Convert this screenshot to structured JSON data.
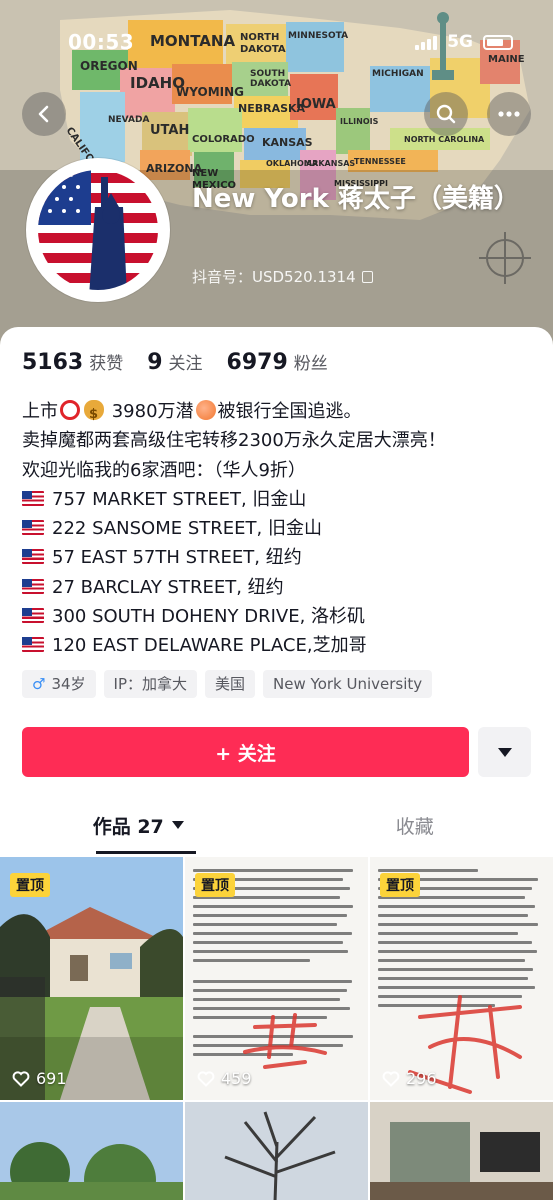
{
  "status_bar": {
    "time": "00:53",
    "network": "5G"
  },
  "profile": {
    "name": "New York  蒋太子（美籍）",
    "douyin_id": "抖音号：USD520.1314"
  },
  "stats": [
    {
      "value": "5163",
      "label": "获赞"
    },
    {
      "value": "9",
      "label": "关注"
    },
    {
      "value": "6979",
      "label": "粉丝"
    }
  ],
  "bio": {
    "line1_a": "上市",
    "line1_b": "3980万潜",
    "line1_c": "被银行全国追逃。",
    "line2": "卖掉魔都两套高级住宅转移2300万永久定居大漂亮！",
    "line3": "欢迎光临我的6家酒吧：（华人9折）",
    "addresses": [
      "757 MARKET STREET, 旧金山",
      "222 SANSOME STREET, 旧金山",
      "57 EAST 57TH STREET, 纽约",
      "27 BARCLAY STREET, 纽约",
      "300 SOUTH DOHENY DRIVE, 洛杉矶",
      "120 EAST DELAWARE PLACE,芝加哥"
    ]
  },
  "tags": {
    "gender_symbol": "♂",
    "age": "34岁",
    "ip": "IP：加拿大",
    "country": "美国",
    "school": "New York University"
  },
  "actions": {
    "follow_label": "+ 关注"
  },
  "tabs": {
    "works": "作品 27",
    "favorites": "收藏"
  },
  "videos": [
    {
      "pinned": "置顶",
      "likes": "691"
    },
    {
      "pinned": "置顶",
      "likes": "459"
    },
    {
      "pinned": "置顶",
      "likes": "296"
    }
  ],
  "map_labels": [
    "MONTANA",
    "NORTH DAKOTA",
    "MINNESOTA",
    "OREGON",
    "IDAHO",
    "WYOMING",
    "SOUTH DAKOTA",
    "NEBRASKA",
    "IOWA",
    "MICHIGAN",
    "MAINE",
    "NEVADA",
    "UTAH",
    "COLORADO",
    "KANSAS",
    "CALIFORNIA",
    "ARIZONA",
    "NEW MEXICO",
    "OKLAHOMA",
    "ARKANSAS",
    "TENNESSEE",
    "NORTH CAROLINA",
    "ILLINOIS",
    "MISSISSIPPI"
  ],
  "colors": {
    "accent": "#fe2c55",
    "pin": "#fcd33a"
  }
}
